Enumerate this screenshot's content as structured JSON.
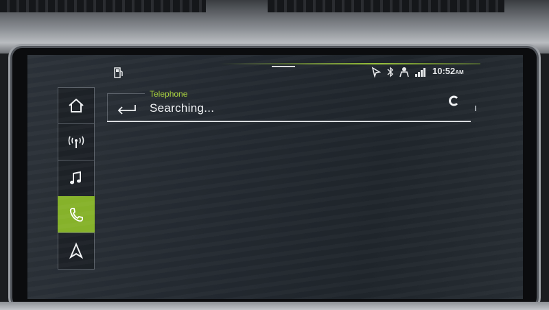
{
  "status_bar": {
    "time": "10:52",
    "ampm": "AM",
    "icons": [
      "fuel-icon",
      "location-icon",
      "bluetooth-icon",
      "person-icon",
      "signal-icon"
    ]
  },
  "nav": {
    "items": [
      {
        "name": "home",
        "icon": "home-icon"
      },
      {
        "name": "radio",
        "icon": "radio-antenna-icon"
      },
      {
        "name": "media",
        "icon": "music-note-icon"
      },
      {
        "name": "phone",
        "icon": "phone-icon",
        "active": true
      },
      {
        "name": "navigation",
        "icon": "navigation-arrow-icon"
      }
    ]
  },
  "header": {
    "app_title": "Telephone",
    "status_text": "Searching..."
  },
  "colors": {
    "accent": "#86b22a",
    "title": "#a6cf3b",
    "screen_bg": "#232930"
  }
}
